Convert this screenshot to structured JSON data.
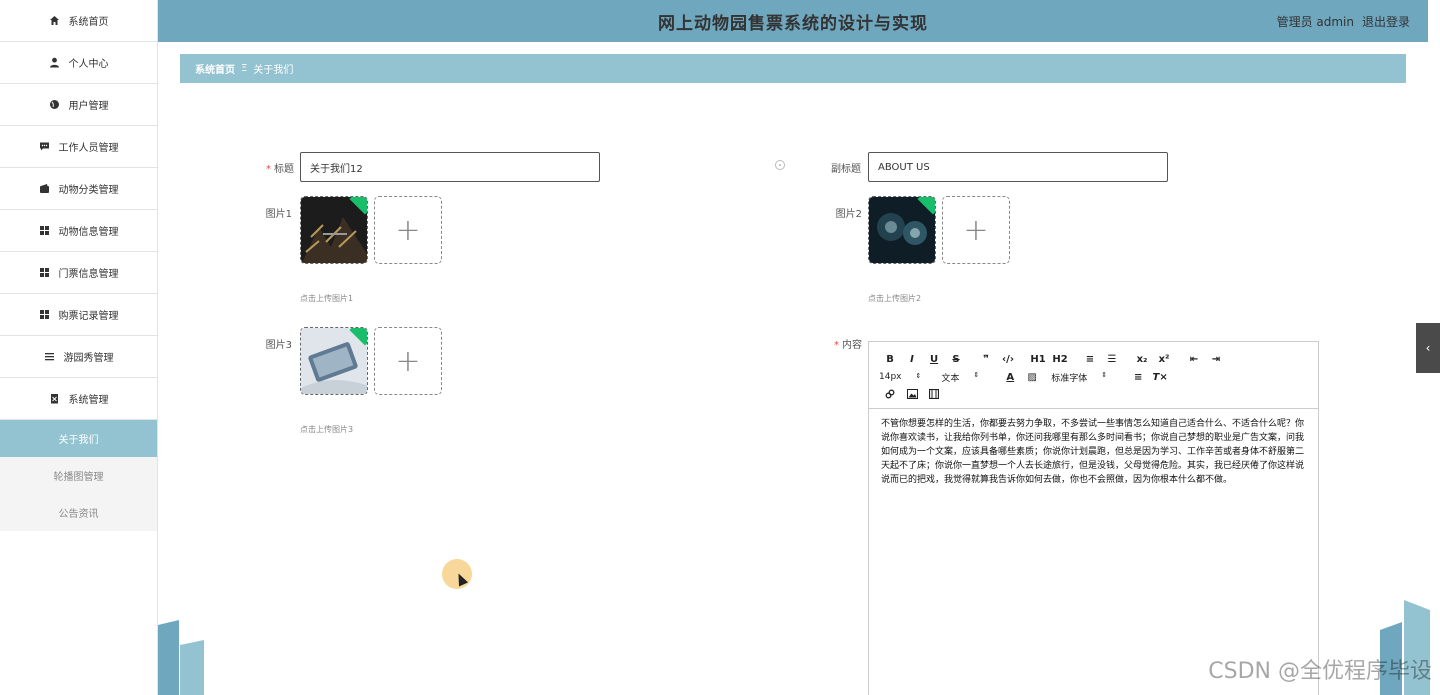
{
  "header": {
    "title": "网上动物园售票系统的设计与实现",
    "user": "管理员 admin",
    "logout": "退出登录"
  },
  "sidebar": {
    "items": [
      {
        "label": "系统首页",
        "icon": "home-icon"
      },
      {
        "label": "个人中心",
        "icon": "user-icon"
      },
      {
        "label": "用户管理",
        "icon": "globe-icon"
      },
      {
        "label": "工作人员管理",
        "icon": "chat-icon"
      },
      {
        "label": "动物分类管理",
        "icon": "wallet-icon"
      },
      {
        "label": "动物信息管理",
        "icon": "grid-icon"
      },
      {
        "label": "门票信息管理",
        "icon": "grid-icon"
      },
      {
        "label": "购票记录管理",
        "icon": "grid-icon"
      },
      {
        "label": "游园秀管理",
        "icon": "list-icon"
      },
      {
        "label": "系统管理",
        "icon": "trash-icon"
      }
    ],
    "sub_items": [
      {
        "label": "关于我们",
        "active": true
      },
      {
        "label": "轮播图管理",
        "active": false
      },
      {
        "label": "公告资讯",
        "active": false
      }
    ]
  },
  "breadcrumb": {
    "home": "系统首页",
    "separator": "Ξ",
    "current": "关于我们"
  },
  "form": {
    "title_label": "标题",
    "title_value": "关于我们12",
    "subtitle_label": "副标题",
    "subtitle_value": "ABOUT US",
    "pic1_label": "图片1",
    "pic1_hint": "点击上传图片1",
    "pic2_label": "图片2",
    "pic2_hint": "点击上传图片2",
    "pic3_label": "图片3",
    "pic3_hint": "点击上传图片3",
    "content_label": "内容",
    "required_mark": "*",
    "upload_plus": "+"
  },
  "editor": {
    "toolbar_row1": [
      "B",
      "I",
      "U",
      "S",
      "❞",
      "‹/›",
      "H1",
      "H2",
      "≡",
      "☰",
      "x₂",
      "x²",
      "⇤",
      "⇥"
    ],
    "font_size": "14px",
    "text_type": "文本",
    "font_family": "标准字体",
    "content": "不管你想要怎样的生活，你都要去努力争取，不多尝试一些事情怎么知道自己适合什么、不适合什么呢？你说你喜欢读书，让我给你列书单，你还问我哪里有那么多时间看书；你说自己梦想的职业是广告文案，问我如何成为一个文案，应该具备哪些素质；你说你计划晨跑，但总是因为学习、工作辛苦或者身体不舒服第二天起不了床；你说你一直梦想一个人去长途旅行，但是没钱，父母觉得危险。其实，我已经厌倦了你这样说说而已的把戏，我觉得就算我告诉你如何去做，你也不会照做，因为你根本什么都不做。"
  },
  "watermark": "CSDN @全优程序毕设",
  "colors": {
    "header": "#6fa7bf",
    "breadcrumb": "#93c3d1",
    "active": "#93c3d1",
    "corner_badge": "#19be6b"
  }
}
